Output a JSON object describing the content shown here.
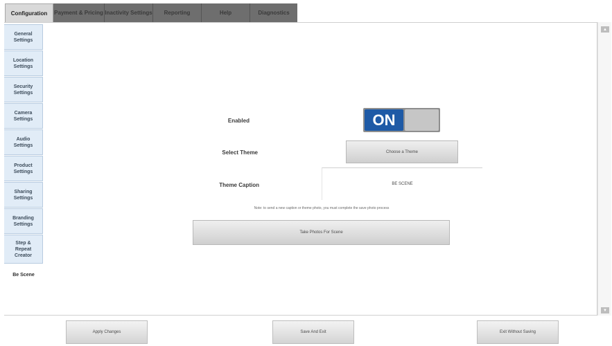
{
  "tabs": [
    "Configuration",
    "Payment & Pricing",
    "Inactivity Settings",
    "Reporting",
    "Help",
    "Diagnostics"
  ],
  "sidebar": {
    "items": [
      {
        "label": "General\nSettings"
      },
      {
        "label": "Location\nSettings"
      },
      {
        "label": "Security\nSettings"
      },
      {
        "label": "Camera\nSettings"
      },
      {
        "label": "Audio\nSettings"
      },
      {
        "label": "Product\nSettings"
      },
      {
        "label": "Sharing\nSettings"
      },
      {
        "label": "Branding\nSettings"
      },
      {
        "label": "Step &\nRepeat\nCreator"
      },
      {
        "label": "Be Scene"
      }
    ]
  },
  "content": {
    "enabled_label": "Enabled",
    "toggle_on": "ON",
    "select_theme_label": "Select Theme",
    "select_theme_button": "Choose a Theme",
    "theme_caption_label": "Theme Caption",
    "theme_caption_value": "BE SCENE",
    "help_text": "Note: to send a new caption or theme photo, you must complete the save photo process",
    "take_photos_button": "Take Photos For Scene"
  },
  "bottom": {
    "apply": "Apply Changes",
    "save": "Save And Exit",
    "exit": "Exit Without Saving"
  },
  "colors": {
    "toggle_on": "#1e5aa6",
    "sidebar_bg": "#e1ecf7",
    "tab_bg": "#6e6e6e"
  }
}
